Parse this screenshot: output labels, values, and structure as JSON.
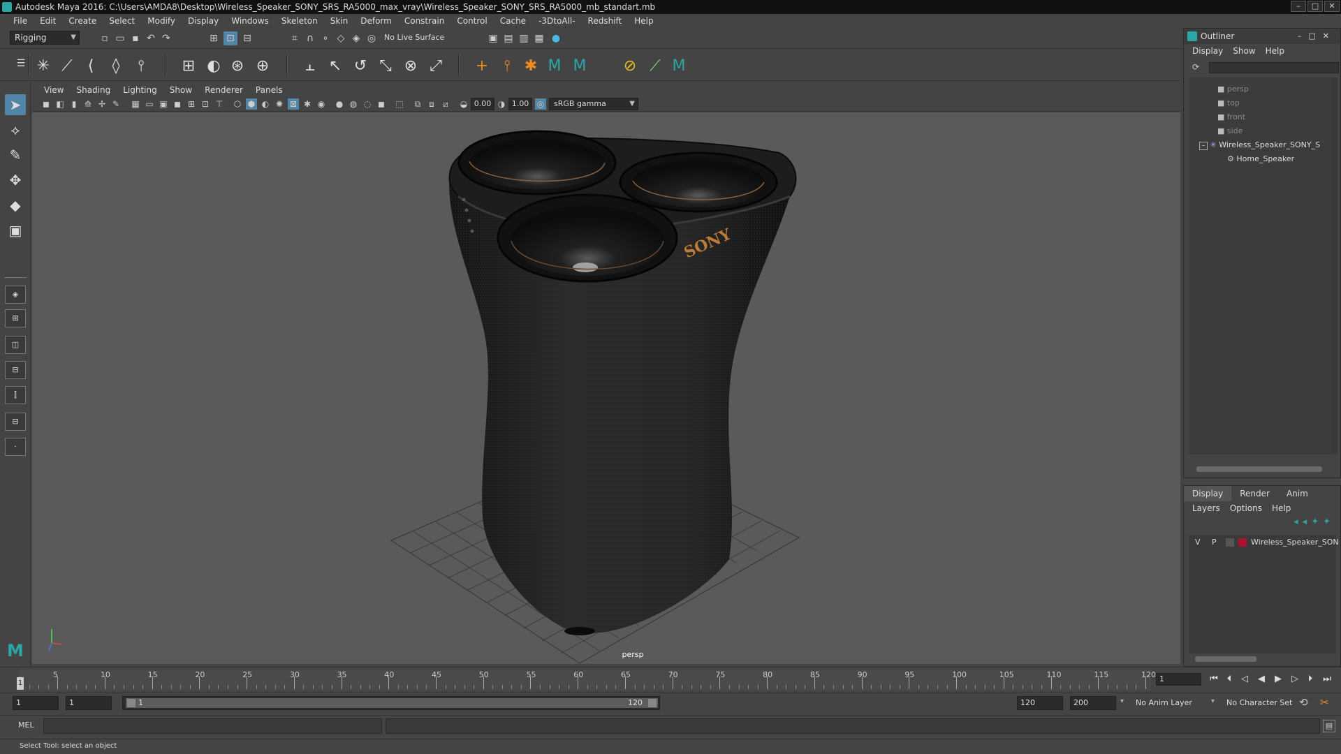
{
  "window": {
    "title": "Autodesk Maya 2016: C:\\Users\\AMDA8\\Desktop\\Wireless_Speaker_SONY_SRS_RA5000_max_vray\\Wireless_Speaker_SONY_SRS_RA5000_mb_standart.mb",
    "min": "–",
    "max": "□",
    "close": "✕"
  },
  "menubar": [
    "File",
    "Edit",
    "Create",
    "Select",
    "Modify",
    "Display",
    "Windows",
    "Skeleton",
    "Skin",
    "Deform",
    "Constrain",
    "Control",
    "Cache",
    "-3DtoAll-",
    "Redshift",
    "Help"
  ],
  "status_line": {
    "menu_set": "Rigging",
    "live_surface": "No Live Surface"
  },
  "viewport": {
    "menu": [
      "View",
      "Shading",
      "Lighting",
      "Show",
      "Renderer",
      "Panels"
    ],
    "exposure": "0.00",
    "gamma": "1.00",
    "color_space": "sRGB gamma",
    "camera": "persp",
    "brand": "SONY"
  },
  "outliner": {
    "title": "Outliner",
    "menu": [
      "Display",
      "Show",
      "Help"
    ],
    "items": [
      {
        "label": "persp"
      },
      {
        "label": "top"
      },
      {
        "label": "front"
      },
      {
        "label": "side"
      },
      {
        "label": "Wireless_Speaker_SONY_S"
      },
      {
        "label": "Home_Speaker"
      }
    ]
  },
  "layer_editor": {
    "tabs": [
      "Display",
      "Render",
      "Anim"
    ],
    "menu": [
      "Layers",
      "Options",
      "Help"
    ],
    "layer": {
      "v": "V",
      "p": "P",
      "name": "Wireless_Speaker_SON",
      "color": "#b01030"
    }
  },
  "time_slider": {
    "ticks": [
      1,
      5,
      10,
      15,
      20,
      25,
      30,
      35,
      40,
      45,
      50,
      55,
      60,
      65,
      70,
      75,
      80,
      85,
      90,
      95,
      100,
      105,
      110,
      115,
      120
    ],
    "current_frame": "1",
    "current_marker": "1"
  },
  "range_slider": {
    "start": "1",
    "anim_start": "1",
    "range_start": "1",
    "range_end": "120",
    "anim_end": "120",
    "end": "200",
    "anim_layer": "No Anim Layer",
    "character_set": "No Character Set"
  },
  "command_line": {
    "mode": "MEL"
  },
  "help_line": "Select Tool: select an object"
}
